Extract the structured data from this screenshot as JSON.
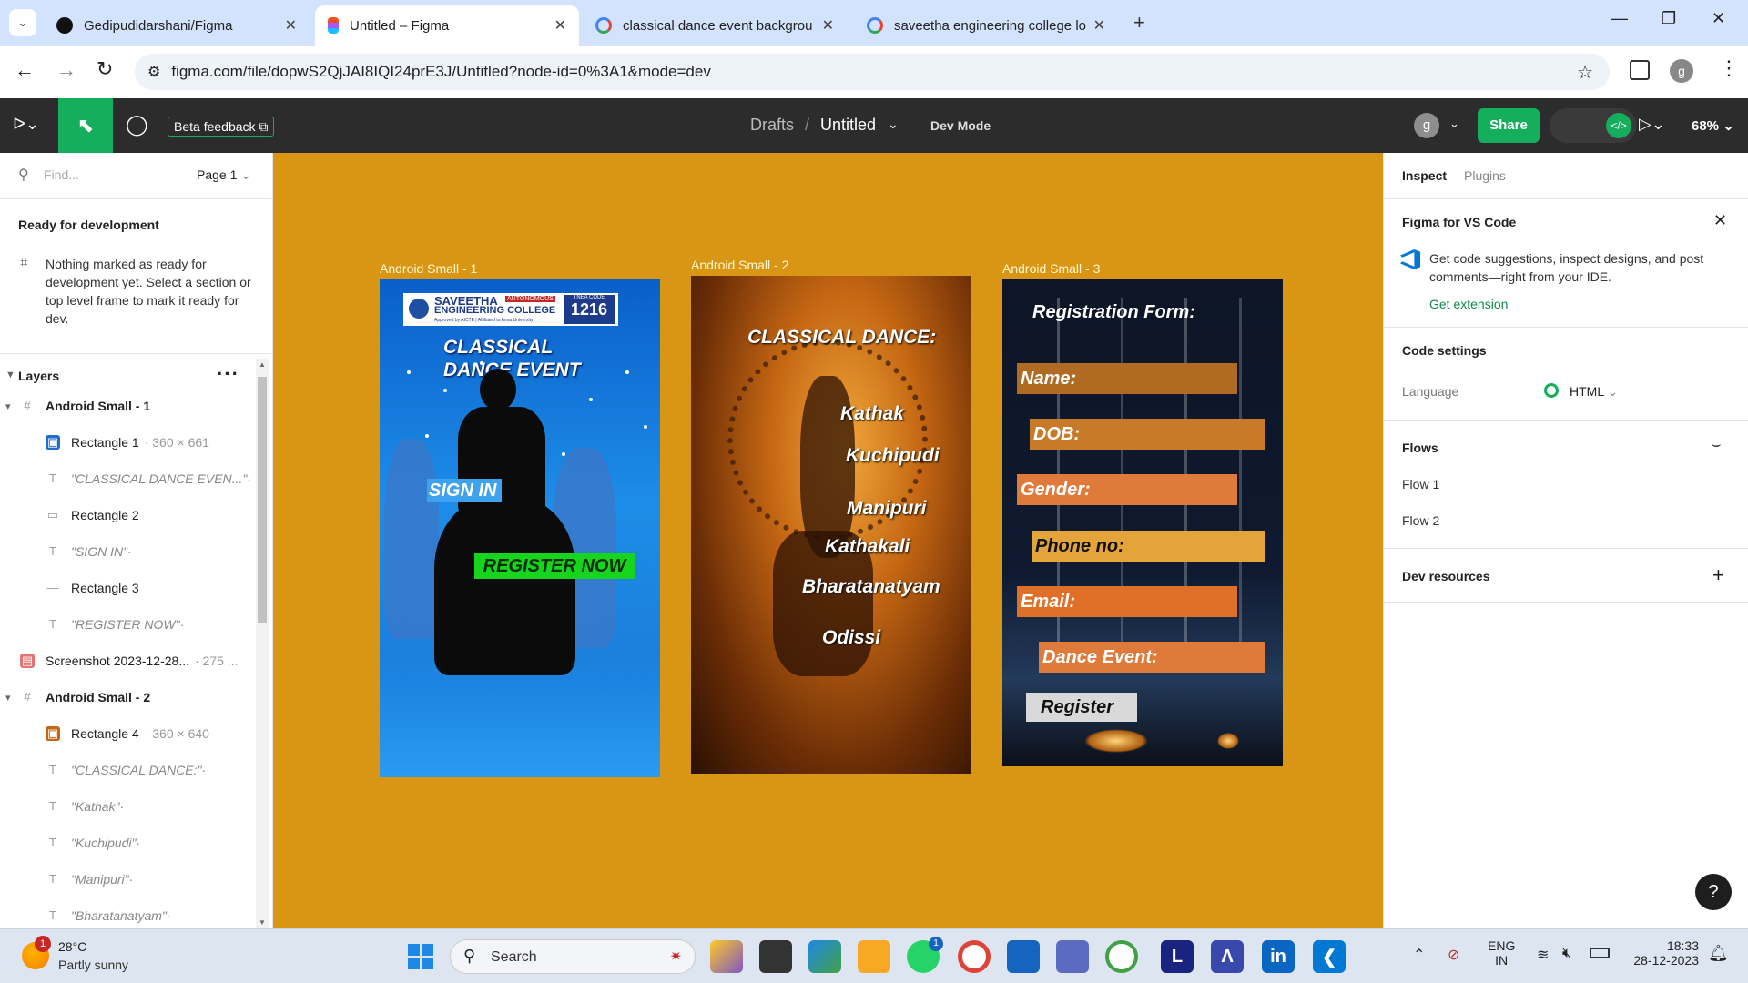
{
  "browser": {
    "tabs": [
      {
        "title": "Gedipudidarshani/Figma",
        "favicon": "github-icon"
      },
      {
        "title": "Untitled – Figma",
        "favicon": "figma-icon"
      },
      {
        "title": "classical dance event backgrou",
        "favicon": "google-icon"
      },
      {
        "title": "saveetha engineering college lo",
        "favicon": "google-icon"
      }
    ],
    "url": "figma.com/file/dopwS2QjJAI8IQI24prE3J/Untitled?node-id=0%3A1&mode=dev",
    "profile_initial": "g"
  },
  "figma": {
    "beta_feedback": "Beta feedback",
    "breadcrumb_drafts": "Drafts",
    "breadcrumb_sep": "/",
    "file_name": "Untitled",
    "dev_mode_label": "Dev Mode",
    "user_initial": "g",
    "share_label": "Share",
    "zoom": "68%"
  },
  "left": {
    "find_placeholder": "Find...",
    "page": "Page 1",
    "ready_title": "Ready for development",
    "ready_desc": "Nothing marked as ready for development yet. Select a section or top level frame to mark it ready for dev.",
    "layers_title": "Layers",
    "layers": [
      {
        "name": "Android Small - 1",
        "kind": "frame",
        "dim": ""
      },
      {
        "name": "Rectangle 1",
        "kind": "image",
        "dim": "· 360 × 661"
      },
      {
        "name": "\"CLASSICAL DANCE EVEN...\"·",
        "kind": "text",
        "dim": ""
      },
      {
        "name": "Rectangle 2",
        "kind": "rect",
        "dim": ""
      },
      {
        "name": "\"SIGN IN\"·",
        "kind": "text",
        "dim": ""
      },
      {
        "name": "Rectangle 3",
        "kind": "line",
        "dim": ""
      },
      {
        "name": "\"REGISTER NOW\"·",
        "kind": "text",
        "dim": ""
      },
      {
        "name": "Screenshot 2023-12-28...",
        "kind": "screenshot",
        "dim": "· 275 ..."
      },
      {
        "name": "Android Small - 2",
        "kind": "frame",
        "dim": ""
      },
      {
        "name": "Rectangle 4",
        "kind": "image",
        "dim": "· 360 × 640"
      },
      {
        "name": "\"CLASSICAL DANCE:\"·",
        "kind": "text",
        "dim": ""
      },
      {
        "name": "\"Kathak\"·",
        "kind": "text",
        "dim": ""
      },
      {
        "name": "\"Kuchipudi\"·",
        "kind": "text",
        "dim": ""
      },
      {
        "name": "\"Manipuri\"·",
        "kind": "text",
        "dim": ""
      },
      {
        "name": "\"Bharatanatyam\"·",
        "kind": "text",
        "dim": ""
      }
    ]
  },
  "canvas": {
    "frame1": {
      "label": "Android Small - 1",
      "college_line1": "SAVEETHA",
      "college_badge": "AUTONOMOUS",
      "college_line2": "ENGINEERING COLLEGE",
      "college_sub": "Approved by AICTE | Affiliated to Anna University",
      "tnea_label": "TNEA CODE",
      "tnea_code": "1216",
      "title": "CLASSICAL DANCE EVENT",
      "sign_in": "SIGN IN",
      "register_now": "REGISTER NOW"
    },
    "frame2": {
      "label": "Android Small - 2",
      "title": "CLASSICAL DANCE:",
      "items": [
        "Kathak",
        "Kuchipudi",
        "Manipuri",
        "Kathakali",
        "Bharatanatyam",
        "Odissi"
      ]
    },
    "frame3": {
      "label": "Android Small - 3",
      "title": "Registration Form:",
      "fields": [
        "Name:",
        "DOB:",
        "Gender:",
        "Phone no:",
        "Email:",
        "Dance Event:"
      ],
      "register": "Register"
    }
  },
  "right": {
    "tab_inspect": "Inspect",
    "tab_plugins": "Plugins",
    "vscode_title": "Figma for VS Code",
    "vscode_desc": "Get code suggestions, inspect designs, and post comments—right from your IDE.",
    "get_extension": "Get extension",
    "code_settings": "Code settings",
    "language_label": "Language",
    "language_value": "HTML",
    "flows_title": "Flows",
    "flows": [
      "Flow 1",
      "Flow 2"
    ],
    "dev_resources": "Dev resources",
    "help": "?"
  },
  "taskbar": {
    "weather_temp": "28°C",
    "weather_desc": "Partly sunny",
    "weather_badge": "1",
    "search_label": "Search",
    "lang_line1": "ENG",
    "lang_line2": "IN",
    "time": "18:33",
    "date": "28-12-2023",
    "whatsapp_badge": "1"
  },
  "colors": {
    "canvas_bg": "#d99615",
    "figma_toolbar": "#2c2c2c",
    "figma_green": "#14ae5c",
    "tab_bar": "#d3e3fd"
  }
}
